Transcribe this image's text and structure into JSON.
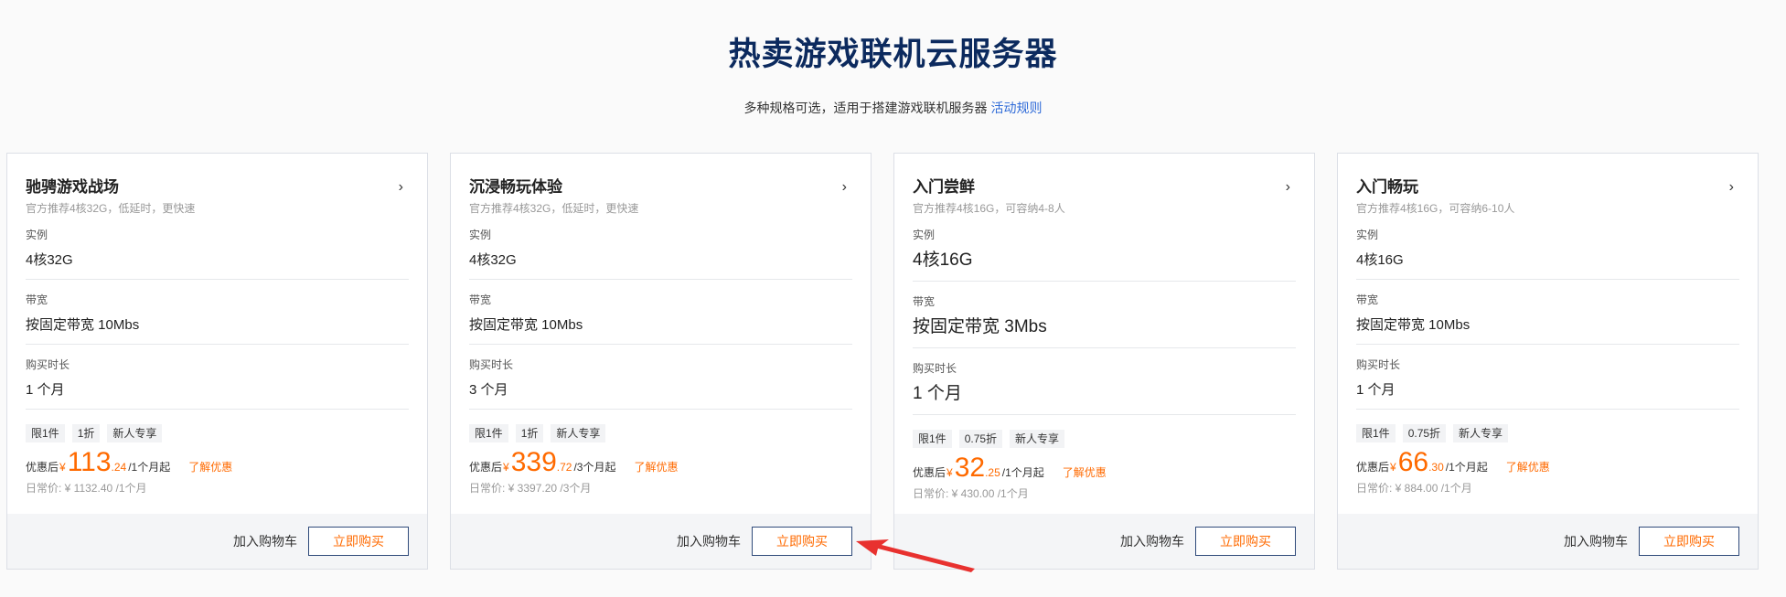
{
  "header": {
    "title": "热卖游戏联机云服务器",
    "subtitle": "多种规格可选，适用于搭建游戏联机服务器",
    "rules_link": "活动规则"
  },
  "labels": {
    "instance": "实例",
    "bandwidth": "带宽",
    "duration": "购买时长",
    "price_prefix": "优惠后",
    "currency": "¥",
    "discount_link": "了解优惠",
    "cart_button": "加入购物车",
    "buy_button": "立即购买"
  },
  "icons": {
    "chevron": "chevron-right-icon",
    "annotation_arrow": "red-arrow-annotation"
  },
  "colors": {
    "accent": "#ff6a00",
    "title": "#0c2a5e",
    "link": "#2f6bd8",
    "annotation": "#e8312f"
  },
  "cards": [
    {
      "title": "驰骋游戏战场",
      "desc": "官方推荐4核32G，低延时，更快速",
      "instance": "4核32G",
      "bandwidth": "按固定带宽 10Mbs",
      "duration": "1 个月",
      "tags": [
        "限1件",
        "1折",
        "新人专享"
      ],
      "price_int": "113",
      "price_dec": ".24",
      "price_unit": "/1个月起",
      "orig_price": "日常价: ¥ 1132.40 /1个月"
    },
    {
      "title": "沉浸畅玩体验",
      "desc": "官方推荐4核32G，低延时，更快速",
      "instance": "4核32G",
      "bandwidth": "按固定带宽 10Mbs",
      "duration": "3 个月",
      "tags": [
        "限1件",
        "1折",
        "新人专享"
      ],
      "price_int": "339",
      "price_dec": ".72",
      "price_unit": "/3个月起",
      "orig_price": "日常价: ¥ 3397.20 /3个月"
    },
    {
      "title": "入门尝鲜",
      "desc": "官方推荐4核16G，可容纳4-8人",
      "instance": "4核16G",
      "bandwidth": "按固定带宽 3Mbs",
      "duration": "1 个月",
      "tags": [
        "限1件",
        "0.75折",
        "新人专享"
      ],
      "price_int": "32",
      "price_dec": ".25",
      "price_unit": "/1个月起",
      "orig_price": "日常价: ¥ 430.00 /1个月"
    },
    {
      "title": "入门畅玩",
      "desc": "官方推荐4核16G，可容纳6-10人",
      "instance": "4核16G",
      "bandwidth": "按固定带宽 10Mbs",
      "duration": "1 个月",
      "tags": [
        "限1件",
        "0.75折",
        "新人专享"
      ],
      "price_int": "66",
      "price_dec": ".30",
      "price_unit": "/1个月起",
      "orig_price": "日常价: ¥ 884.00 /1个月"
    }
  ]
}
